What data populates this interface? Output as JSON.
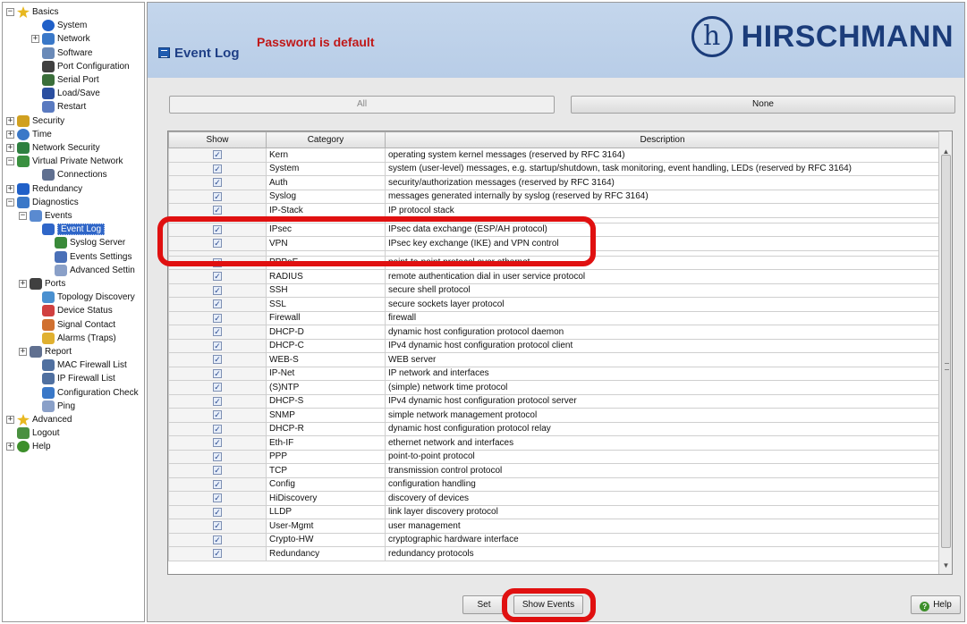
{
  "sidebar": {
    "items": [
      {
        "label": "Basics",
        "expander": "⊟",
        "icon": "star-icon"
      },
      {
        "label": "System",
        "icon": "info-icon"
      },
      {
        "label": "Network",
        "expander": "⊞",
        "icon": "network-icon"
      },
      {
        "label": "Software",
        "icon": "software-icon"
      },
      {
        "label": "Port Configuration",
        "icon": "port-icon"
      },
      {
        "label": "Serial Port",
        "icon": "serial-port-icon"
      },
      {
        "label": "Load/Save",
        "icon": "save-icon"
      },
      {
        "label": "Restart",
        "icon": "restart-icon"
      },
      {
        "label": "Security",
        "expander": "⊞",
        "icon": "lock-icon"
      },
      {
        "label": "Time",
        "expander": "⊞",
        "icon": "clock-icon"
      },
      {
        "label": "Network Security",
        "expander": "⊞",
        "icon": "network-security-icon"
      },
      {
        "label": "Virtual Private Network",
        "expander": "⊟",
        "icon": "vpn-icon"
      },
      {
        "label": "Connections",
        "icon": "connections-icon"
      },
      {
        "label": "Redundancy",
        "expander": "⊞",
        "icon": "redundancy-icon"
      },
      {
        "label": "Diagnostics",
        "expander": "⊟",
        "icon": "diagnostics-icon"
      },
      {
        "label": "Events",
        "expander": "⊟",
        "icon": "events-icon"
      },
      {
        "label": "Event Log",
        "icon": "event-log-icon"
      },
      {
        "label": "Syslog Server",
        "icon": "syslog-icon"
      },
      {
        "label": "Events Settings",
        "icon": "events-settings-icon"
      },
      {
        "label": "Advanced Settin",
        "icon": "advanced-settings-icon"
      },
      {
        "label": "Ports",
        "expander": "⊞",
        "icon": "ports-icon"
      },
      {
        "label": "Topology Discovery",
        "icon": "topology-icon"
      },
      {
        "label": "Device Status",
        "icon": "device-status-icon"
      },
      {
        "label": "Signal Contact",
        "icon": "signal-contact-icon"
      },
      {
        "label": "Alarms (Traps)",
        "icon": "alarm-icon"
      },
      {
        "label": "Report",
        "expander": "⊞",
        "icon": "report-icon"
      },
      {
        "label": "MAC Firewall List",
        "icon": "mac-firewall-icon"
      },
      {
        "label": "IP Firewall List",
        "icon": "ip-firewall-icon"
      },
      {
        "label": "Configuration Check",
        "icon": "config-check-icon"
      },
      {
        "label": "Ping",
        "icon": "ping-icon"
      },
      {
        "label": "Advanced",
        "expander": "⊞",
        "icon": "star-icon"
      },
      {
        "label": "Logout",
        "icon": "logout-icon"
      },
      {
        "label": "Help",
        "expander": "⊞",
        "icon": "help-icon"
      }
    ]
  },
  "header": {
    "page_title": "Event Log",
    "warning": "Password is default",
    "brand_name": "HIRSCHMANN",
    "brand_logo_glyph": "h"
  },
  "buttons": {
    "all": "All",
    "none": "None",
    "set": "Set",
    "show_events": "Show Events",
    "help": "Help"
  },
  "table": {
    "columns": [
      "Show",
      "Category",
      "Description"
    ],
    "rows": [
      {
        "category": "Kern",
        "description": "operating system kernel messages (reserved by RFC 3164)"
      },
      {
        "category": "System",
        "description": "system (user-level) messages, e.g. startup/shutdown, task monitoring, event handling, LEDs (reserved by RFC 3164)"
      },
      {
        "category": "Auth",
        "description": "security/authorization messages (reserved by RFC 3164)"
      },
      {
        "category": "Syslog",
        "description": "messages generated internally by syslog (reserved by RFC 3164)"
      },
      {
        "category": "IP-Stack",
        "description": "IP protocol stack"
      },
      {
        "category": "",
        "description": "",
        "partial": true
      },
      {
        "category": "IPsec",
        "description": "IPsec data exchange (ESP/AH protocol)"
      },
      {
        "category": "VPN",
        "description": "IPsec key exchange (IKE) and VPN control"
      },
      {
        "category": "",
        "description": "",
        "partial": true
      },
      {
        "category": "PPPoE",
        "description": "point-to-point protocol over ethernet"
      },
      {
        "category": "RADIUS",
        "description": "remote authentication dial in user service protocol"
      },
      {
        "category": "SSH",
        "description": "secure shell protocol"
      },
      {
        "category": "SSL",
        "description": "secure sockets layer protocol"
      },
      {
        "category": "Firewall",
        "description": "firewall"
      },
      {
        "category": "DHCP-D",
        "description": "dynamic host configuration protocol daemon"
      },
      {
        "category": "DHCP-C",
        "description": "IPv4 dynamic host configuration protocol client"
      },
      {
        "category": "WEB-S",
        "description": "WEB server"
      },
      {
        "category": "IP-Net",
        "description": "IP network and interfaces"
      },
      {
        "category": "(S)NTP",
        "description": "(simple) network time protocol"
      },
      {
        "category": "DHCP-S",
        "description": "IPv4 dynamic host configuration protocol server"
      },
      {
        "category": "SNMP",
        "description": "simple network management protocol"
      },
      {
        "category": "DHCP-R",
        "description": "dynamic host configuration protocol relay"
      },
      {
        "category": "Eth-IF",
        "description": "ethernet network and interfaces"
      },
      {
        "category": "PPP",
        "description": "point-to-point protocol"
      },
      {
        "category": "TCP",
        "description": "transmission control protocol"
      },
      {
        "category": "Config",
        "description": "configuration handling"
      },
      {
        "category": "HiDiscovery",
        "description": "discovery of devices"
      },
      {
        "category": "LLDP",
        "description": "link layer discovery protocol"
      },
      {
        "category": "User-Mgmt",
        "description": "user management"
      },
      {
        "category": "Crypto-HW",
        "description": "cryptographic hardware interface"
      },
      {
        "category": "Redundancy",
        "description": "redundancy protocols"
      }
    ]
  },
  "colors": {
    "header_bg": "#c4d6ec",
    "brand": "#1b3c7a",
    "warning": "#c01818",
    "highlight": "#e01010",
    "selection": "#2f66c8"
  }
}
